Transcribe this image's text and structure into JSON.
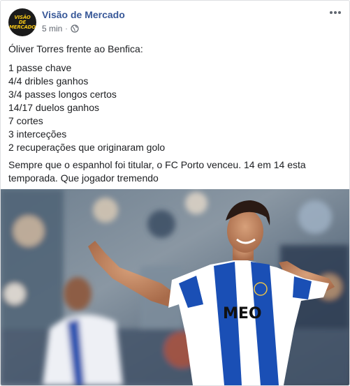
{
  "post": {
    "page_name": "Visão de Mercado",
    "avatar_text": [
      "VISÃO",
      "DE",
      "MERCADO"
    ],
    "timestamp": "5 min",
    "separator": "·",
    "privacy_icon": "globe-icon",
    "more_icon": "ellipsis-icon",
    "intro": "Óliver Torres frente ao Benfica:",
    "stats": [
      "1 passe chave",
      "4/4 dribles ganhos",
      "3/4 passes longos certos",
      "14/17 duelos ganhos",
      "7 cortes",
      "3 interceções",
      "2 recuperações que originaram golo"
    ],
    "closing": "Sempre que o espanhol foi titular, o FC Porto venceu. 14 em 14 esta temporada. Que jogador tremendo",
    "photo": {
      "shirt_sponsor": "MEO",
      "colors": {
        "porto_blue": "#1a4fb5",
        "white": "#ffffff",
        "brand_link": "#385898"
      }
    }
  }
}
